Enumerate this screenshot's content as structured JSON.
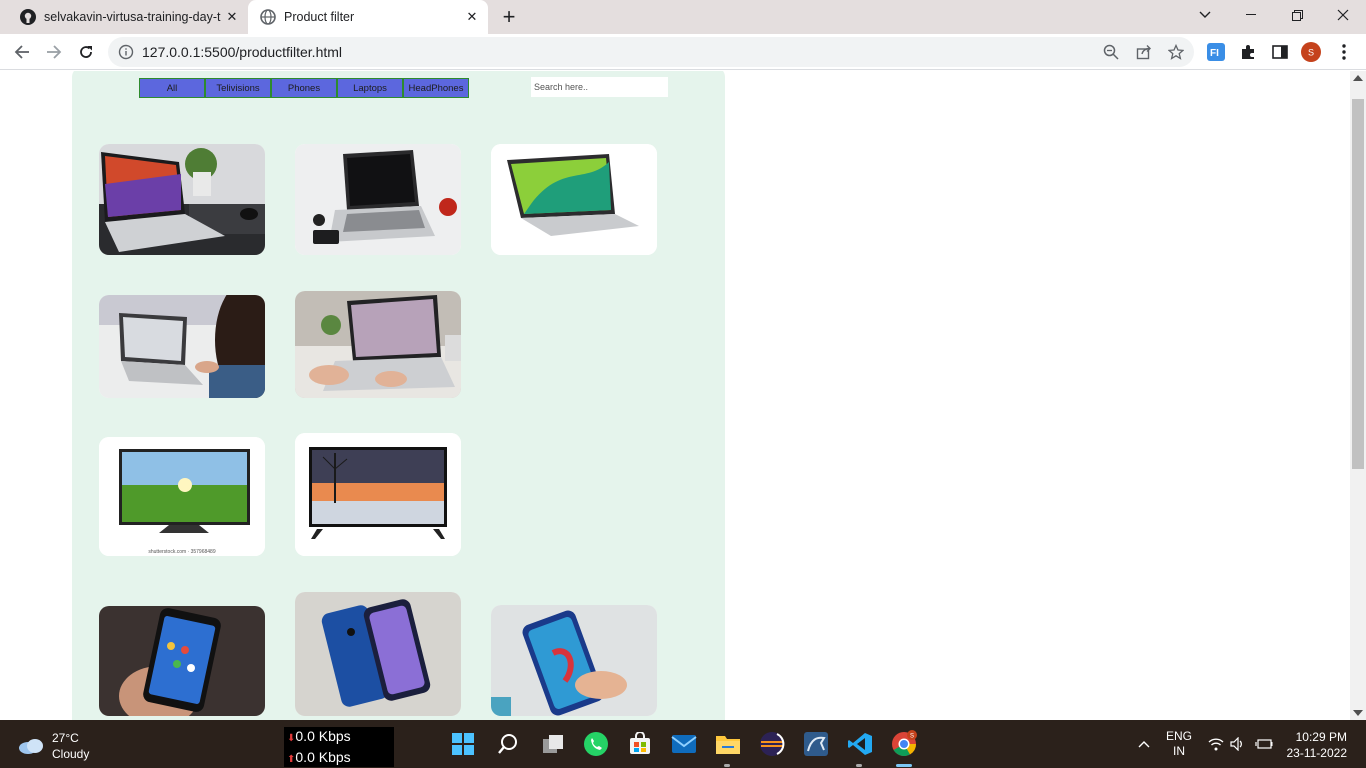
{
  "browser": {
    "tabs": [
      {
        "title": "selvakavin-virtusa-training-day-t",
        "favicon": "github-icon",
        "active": false
      },
      {
        "title": "Product filter",
        "favicon": "globe-icon",
        "active": true
      }
    ],
    "url": "127.0.0.1:5500/productfilter.html",
    "profile_initial": "S"
  },
  "page": {
    "filters": [
      "All",
      "Telivisions",
      "Phones",
      "Laptops",
      "HeadPhones"
    ],
    "search_placeholder": "Search here..",
    "products": [
      {
        "category": "laptop",
        "image": "laptop-on-desk-with-plant"
      },
      {
        "category": "laptop",
        "image": "laptop-with-apple-and-phone"
      },
      {
        "category": "laptop",
        "image": "laptop-green-screen"
      },
      {
        "category": "laptop",
        "image": "woman-using-laptop"
      },
      {
        "category": "laptop",
        "image": "hands-typing-on-laptop"
      },
      {
        "category": "television",
        "image": "tv-green-field",
        "caption": "shutterstock.com · 357968489"
      },
      {
        "category": "television",
        "image": "tv-winter-sunset"
      },
      {
        "category": "phone",
        "image": "hand-holding-iphone"
      },
      {
        "category": "phone",
        "image": "two-oneplus-phones"
      },
      {
        "category": "phone",
        "image": "hand-holding-android-phone"
      }
    ],
    "colors": {
      "panel": "#e5f4ec",
      "filter_button": "#5c67de"
    }
  },
  "taskbar": {
    "weather": {
      "temp": "27°C",
      "condition": "Cloudy"
    },
    "net": {
      "down": "0.0 Kbps",
      "up": "0.0 Kbps"
    },
    "language": {
      "lang": "ENG",
      "region": "IN"
    },
    "time": "10:29 PM",
    "date": "23-11-2022",
    "chrome_badge": "S"
  }
}
